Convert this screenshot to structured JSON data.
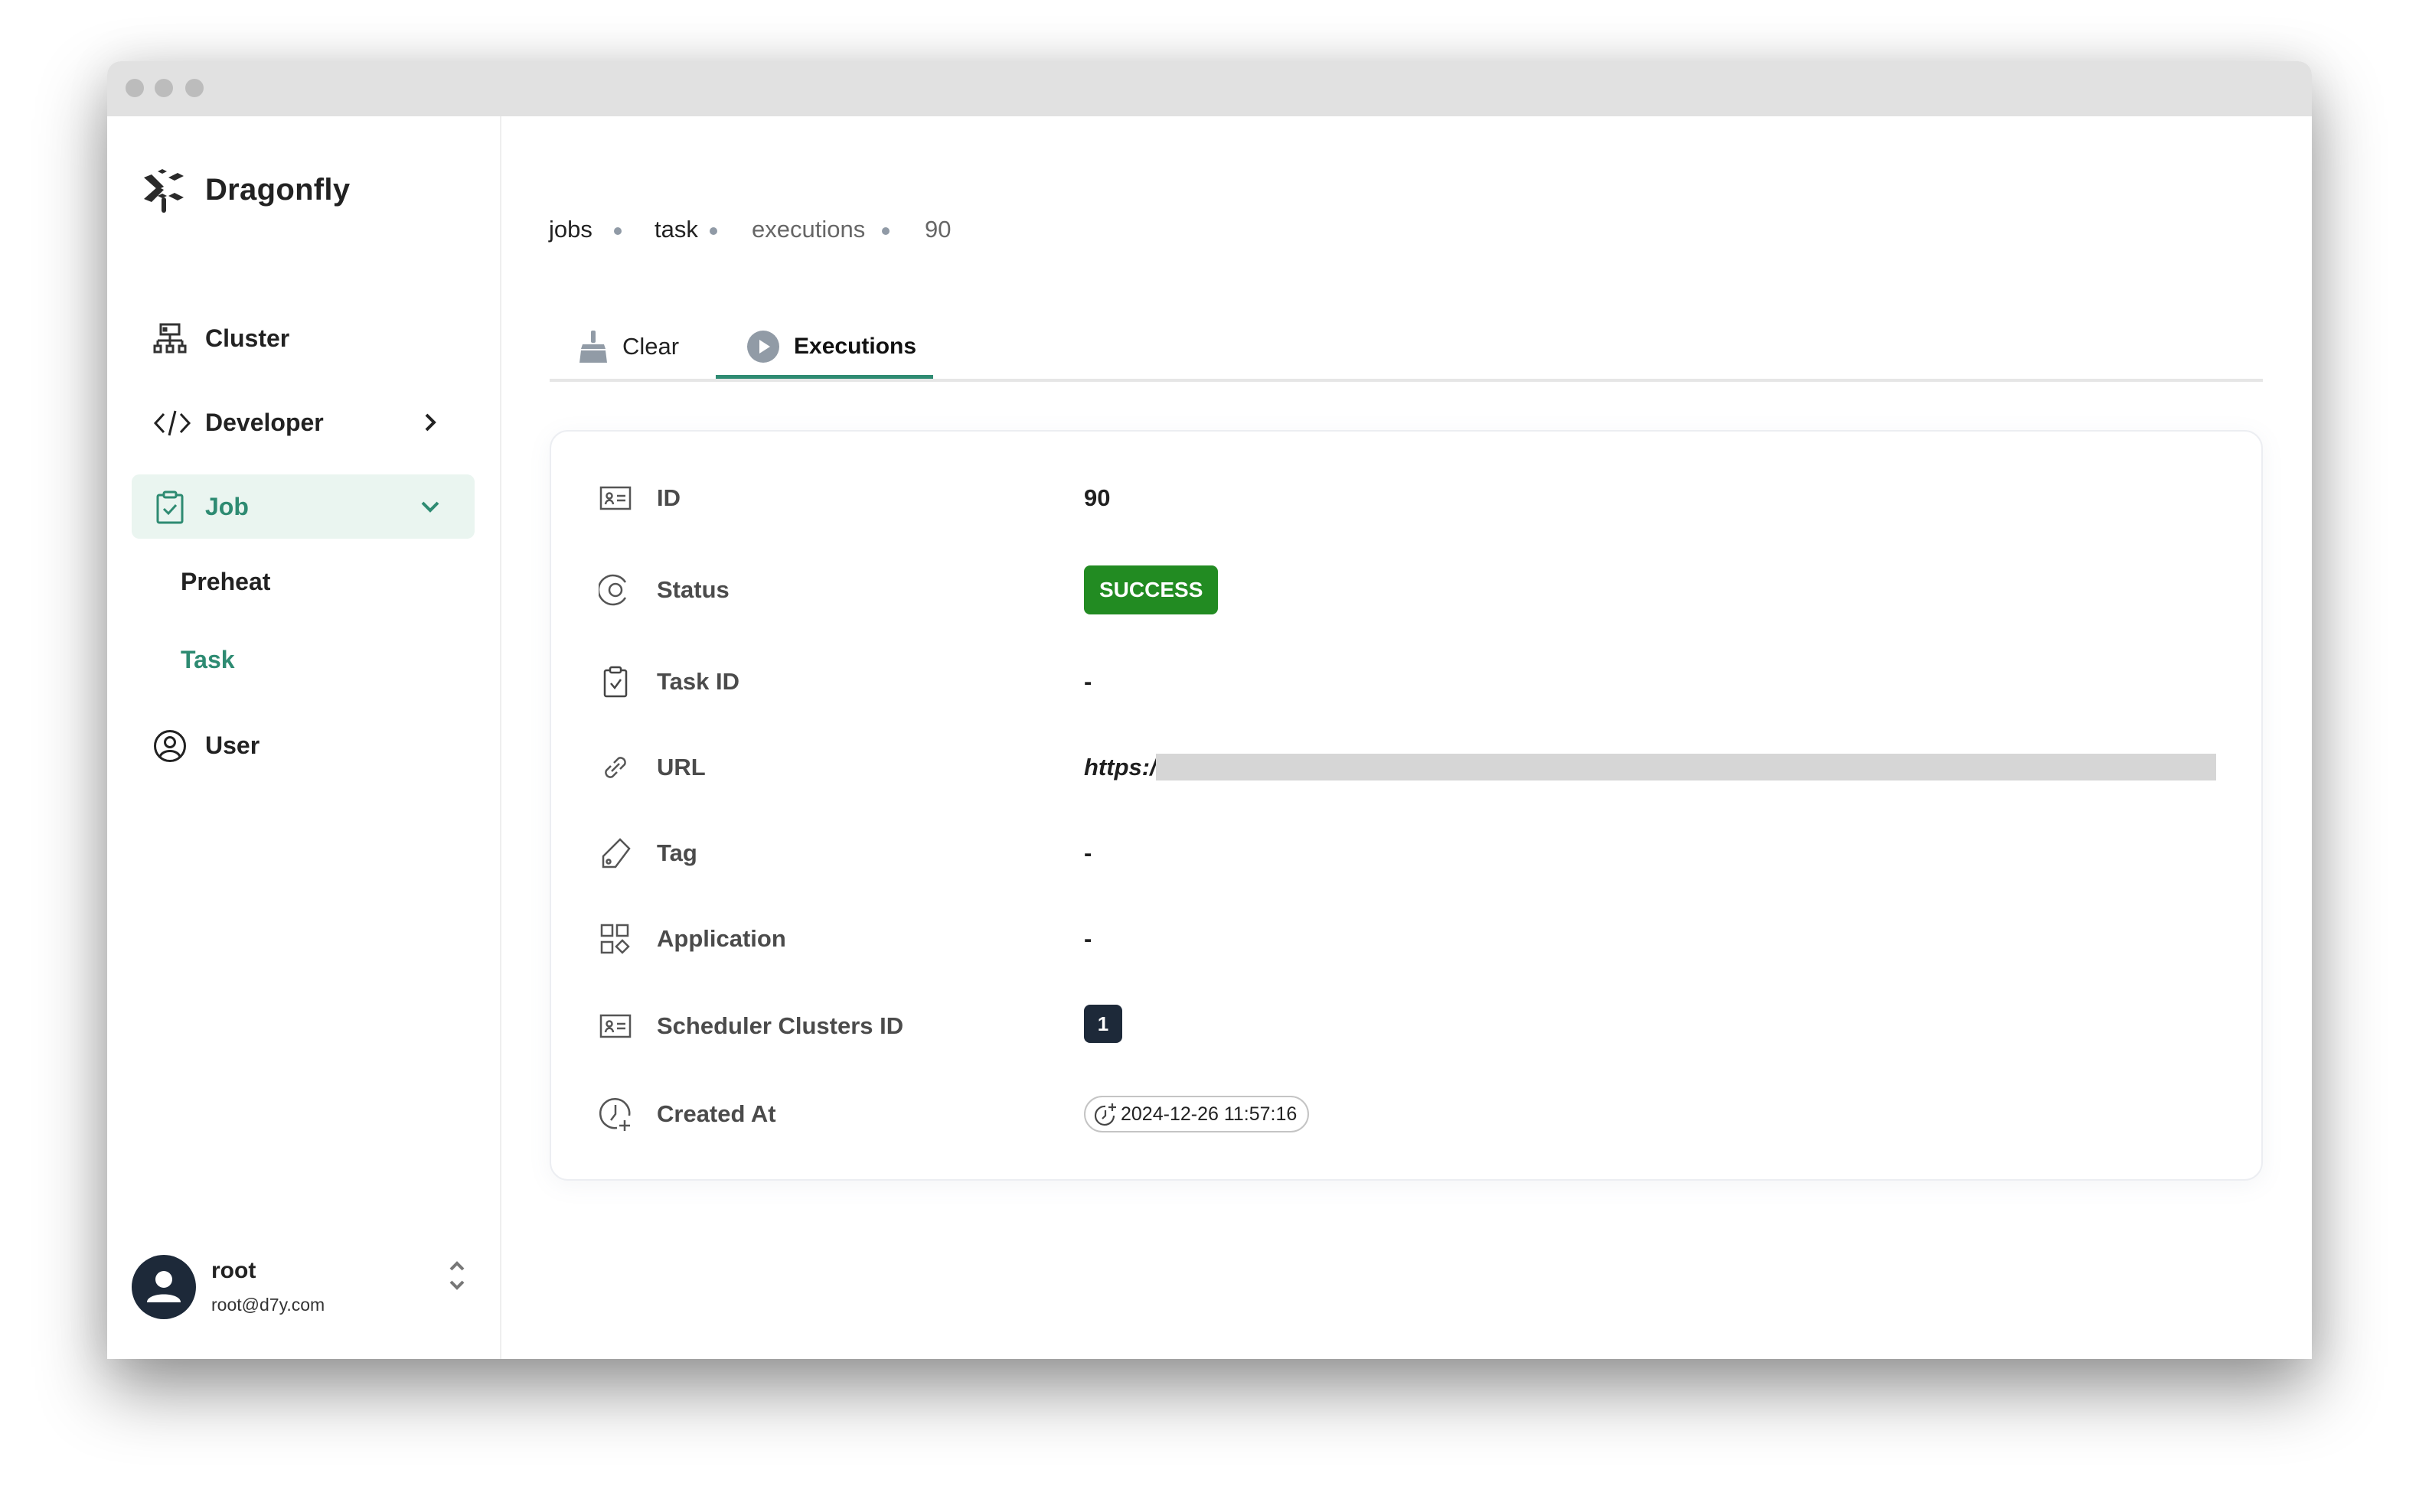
{
  "app": {
    "name": "Dragonfly"
  },
  "sidebar": {
    "items": [
      {
        "label": "Cluster",
        "icon": "cluster-icon"
      },
      {
        "label": "Developer",
        "icon": "code-icon",
        "chevron": "chevron-right-icon"
      },
      {
        "label": "Job",
        "icon": "clipboard-check-icon",
        "chevron": "chevron-down-icon",
        "active": true,
        "children": [
          {
            "label": "Preheat"
          },
          {
            "label": "Task",
            "active": true
          }
        ]
      },
      {
        "label": "User",
        "icon": "user-circle-icon"
      }
    ],
    "user": {
      "name": "root",
      "email": "root@d7y.com"
    }
  },
  "breadcrumb": [
    "jobs",
    "task",
    "executions",
    "90"
  ],
  "tabs": [
    {
      "label": "Clear",
      "icon": "broom-icon"
    },
    {
      "label": "Executions",
      "icon": "play-circle-icon",
      "active": true
    }
  ],
  "details": {
    "rows": [
      {
        "label": "ID",
        "icon": "id-card-icon",
        "value": "90"
      },
      {
        "label": "Status",
        "icon": "status-ring-icon",
        "value": "SUCCESS"
      },
      {
        "label": "Task ID",
        "icon": "clipboard-check-icon",
        "value": "-"
      },
      {
        "label": "URL",
        "icon": "link-icon",
        "value": "https:/"
      },
      {
        "label": "Tag",
        "icon": "tag-icon",
        "value": "-"
      },
      {
        "label": "Application",
        "icon": "apps-icon",
        "value": "-"
      },
      {
        "label": "Scheduler Clusters ID",
        "icon": "id-card-icon",
        "value": "1"
      },
      {
        "label": "Created At",
        "icon": "clock-plus-icon",
        "value": "2024-12-26 11:57:16"
      }
    ]
  },
  "colors": {
    "accent": "#2e8b72",
    "success": "#228b22",
    "dark": "#1d2939",
    "active_bg": "#eaf5f0"
  }
}
